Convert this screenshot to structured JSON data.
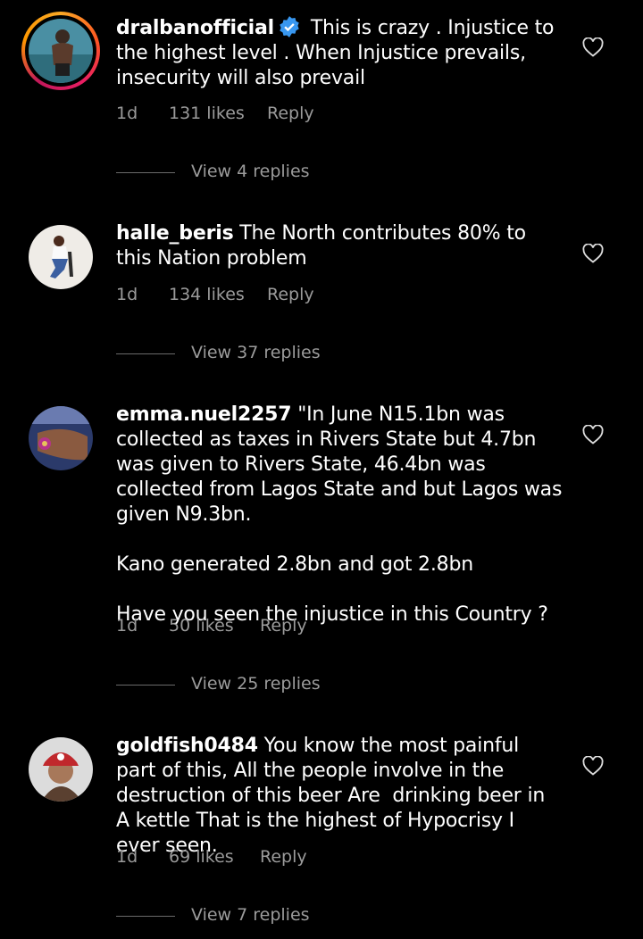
{
  "comments": [
    {
      "username": "dralbanofficial",
      "verified": true,
      "text": "This is crazy . Injustice to the highest level . When Injustice prevails, insecurity will also prevail",
      "time": "1d",
      "likes": "131 likes",
      "reply": "Reply",
      "view_replies": "View 4 replies",
      "icon": "heart-outline-icon"
    },
    {
      "username": "halle_beris",
      "verified": false,
      "text": "The North contributes 80% to this Nation problem",
      "time": "1d",
      "likes": "134 likes",
      "reply": "Reply",
      "view_replies": "View 37 replies",
      "icon": "heart-outline-icon"
    },
    {
      "username": "emma.nuel2257",
      "verified": false,
      "text": "\"In June N15.1bn was collected as taxes in Rivers State but 4.7bn was given to Rivers State, 46.4bn was collected from Lagos State and but Lagos was given N9.3bn.\n\nKano generated 2.8bn and got 2.8bn\n\nHave you seen the injustice in this Country ?",
      "time": "1d",
      "likes": "50 likes",
      "reply": "Reply",
      "view_replies": "View 25 replies",
      "icon": "heart-outline-icon"
    },
    {
      "username": "goldfish0484",
      "verified": false,
      "text": "You know the most painful part of this, All the people involve in the destruction of this beer Are  drinking beer in A kettle That is the highest of Hypocrisy I ever seen.",
      "time": "1d",
      "likes": "69 likes",
      "reply": "Reply",
      "view_replies": "View 7 replies",
      "icon": "heart-outline-icon"
    }
  ],
  "colors": {
    "background": "#000000",
    "text": "#ffffff",
    "muted": "#9b9b9b",
    "verified": "#3897f0"
  }
}
